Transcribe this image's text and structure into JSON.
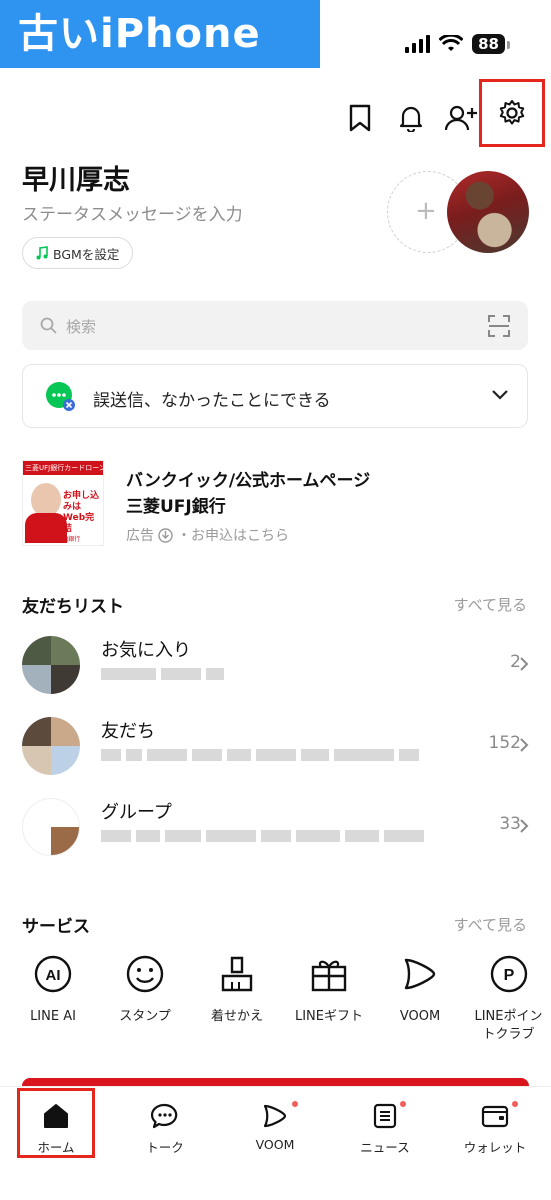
{
  "status_bar": {
    "watermark": "古いiPhone",
    "battery": "88"
  },
  "profile": {
    "name": "早川厚志",
    "status_message_placeholder": "ステータスメッセージを入力",
    "bgm_label": "BGMを設定"
  },
  "search": {
    "placeholder": "検索"
  },
  "notice": {
    "text": "誤送信、なかったことにできる"
  },
  "ad": {
    "title_line1": "バンクイック/公式ホームページ",
    "title_line2": "三菱UFJ銀行",
    "label": "広告",
    "link": "・お申込はこちら",
    "image_band": "三菱UFJ銀行カードローン",
    "image_text": "お申し込みは Web完結",
    "image_brand": "MUFG 三菱UFJ銀行"
  },
  "friends": {
    "title": "友だちリスト",
    "see_all": "すべて見る",
    "rows": [
      {
        "label": "お気に入り",
        "count": "2"
      },
      {
        "label": "友だち",
        "count": "152"
      },
      {
        "label": "グループ",
        "count": "33"
      }
    ]
  },
  "services": {
    "title": "サービス",
    "see_all": "すべて見る",
    "items": [
      {
        "label": "LINE AI",
        "icon": "ai-icon"
      },
      {
        "label": "スタンプ",
        "icon": "smiley-icon"
      },
      {
        "label": "着せかえ",
        "icon": "brush-icon"
      },
      {
        "label": "LINEギフト",
        "icon": "gift-icon"
      },
      {
        "label": "VOOM",
        "icon": "voom-icon"
      },
      {
        "label": "LINEポイントクラブ",
        "label_l1": "LINEポイン",
        "label_l2": "トクラブ",
        "icon": "points-icon"
      }
    ]
  },
  "bottom_nav": {
    "items": [
      {
        "label": "ホーム",
        "icon": "home-icon"
      },
      {
        "label": "トーク",
        "icon": "chat-icon"
      },
      {
        "label": "VOOM",
        "icon": "voom-icon"
      },
      {
        "label": "ニュース",
        "icon": "news-icon"
      },
      {
        "label": "ウォレット",
        "icon": "wallet-icon"
      }
    ]
  },
  "colors": {
    "accent_red": "#e4261c",
    "line_green": "#06c755",
    "ad_red": "#d0121b",
    "watermark_blue": "#2f93f0"
  }
}
